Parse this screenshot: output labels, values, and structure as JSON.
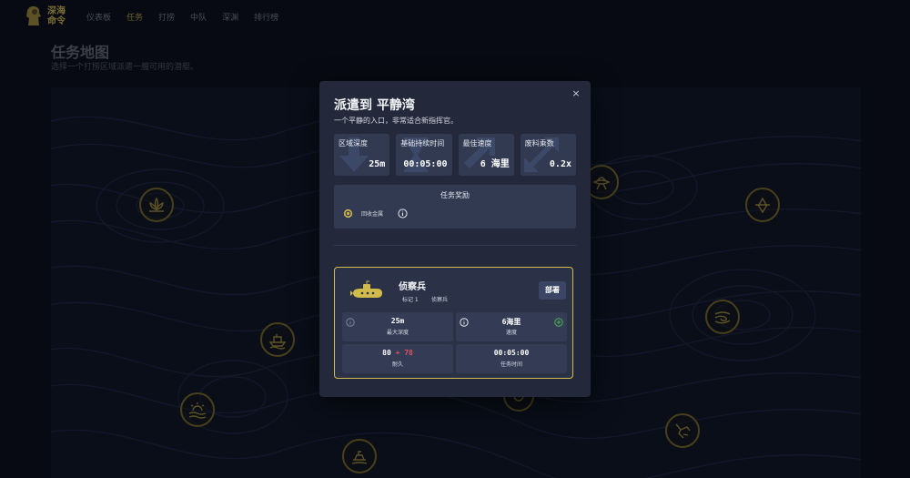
{
  "app": {
    "logo_text": "深海\n命令",
    "nav": [
      "仪表板",
      "任务",
      "打捞",
      "中队",
      "深渊",
      "排行榜"
    ],
    "active_nav": 1
  },
  "page": {
    "title": "任务地图",
    "subtitle": "选择一个打捞区域派遣一艘可用的潜艇。"
  },
  "map": {
    "zones": [
      "lotus-icon",
      "ufo-icon",
      "iceberg-icon",
      "ship-icon",
      "swirl-icon",
      "sun-icon",
      "crack-icon",
      "wreck-icon"
    ]
  },
  "modal": {
    "title": "派遣到 平静湾",
    "subtitle": "一个平静的入口，非常适合新指挥官。",
    "close_label": "×",
    "stats": [
      {
        "label": "区域深度",
        "value": "25m",
        "icon": "arrow-down-icon"
      },
      {
        "label": "基础持续时间",
        "value": "00:05:00",
        "icon": "hourglass-icon"
      },
      {
        "label": "最佳速度",
        "value": "6 海里",
        "icon": "arrow-diag-icon"
      },
      {
        "label": "废料乘数",
        "value": "0.2x",
        "icon": "arrows-out-icon"
      }
    ],
    "rewards": {
      "title": "任务奖励",
      "item_label": "回收金属"
    },
    "submarine": {
      "name": "侦察兵",
      "tag_level": "标记 1",
      "tag_class": "侦察兵",
      "deploy_label": "部署",
      "max_depth_value": "25m",
      "max_depth_label": "最大深度",
      "speed_value": "6海里",
      "speed_label": "速度",
      "durability_value": "80",
      "durability_bonus": "+ 78",
      "durability_label": "耐久",
      "mission_time_value": "00:05:00",
      "mission_time_label": "任务时间"
    }
  },
  "colors": {
    "accent": "#d1bb4a",
    "zone_border": "#6e5f22",
    "bonus": "#e0515d",
    "speed_up": "#4caf50"
  }
}
